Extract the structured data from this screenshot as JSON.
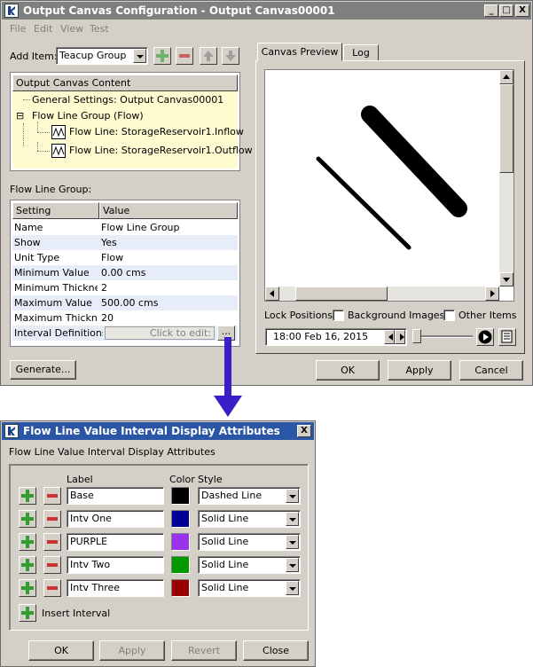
{
  "main_window": {
    "title": "Output Canvas Configuration - Output Canvas00001",
    "title_buttons": [
      "_",
      "□",
      "X"
    ],
    "menu": [
      "File",
      "Edit",
      "View",
      "Test"
    ],
    "add_item_label": "Add Item:",
    "add_item_value": "Teacup Group",
    "content_header": "Output Canvas Content",
    "tree": {
      "general": "General Settings: Output Canvas00001",
      "group": "Flow Line Group (Flow)",
      "expander": "⊟",
      "child1": "Flow Line: StorageReservoir1.Inflow",
      "child2": "Flow Line: StorageReservoir1.Outflow"
    },
    "group_section_label": "Flow Line Group:",
    "settings_headers": [
      "Setting",
      "Value"
    ],
    "settings": [
      {
        "setting": "Name",
        "value": "Flow Line Group"
      },
      {
        "setting": "Show",
        "value": "Yes"
      },
      {
        "setting": "Unit Type",
        "value": "Flow"
      },
      {
        "setting": "Minimum Value",
        "value": "0.00 cms"
      },
      {
        "setting": "Minimum Thickness",
        "value": "2"
      },
      {
        "setting": "Maximum Value",
        "value": "500.00 cms"
      },
      {
        "setting": "Maximum Thickness",
        "value": "20"
      }
    ],
    "interval_def_label": "Interval Definitions",
    "interval_def_value": "Click to edit:",
    "ellipsis": "...",
    "generate_button": "Generate...",
    "tabs": [
      "Canvas Preview",
      "Log"
    ],
    "lock_positions_label": "Lock Positions:",
    "lock_bg_label": "Background Images",
    "lock_other_label": "Other Items",
    "datetime": "18:00 Feb 16, 2015",
    "ok": "OK",
    "apply": "Apply",
    "cancel": "Cancel"
  },
  "dialog": {
    "title": "Flow Line Value Interval Display Attributes",
    "close": "X",
    "subtitle": "Flow Line Value Interval Display Attributes",
    "headers": {
      "label": "Label",
      "color": "Color",
      "style": "Style"
    },
    "intervals": [
      {
        "label": "Base",
        "color": "#000000",
        "style": "Dashed Line"
      },
      {
        "label": "Intv One",
        "color": "#000099",
        "style": "Solid Line"
      },
      {
        "label": "PURPLE",
        "color": "#9933ee",
        "style": "Solid Line"
      },
      {
        "label": "Intv Two",
        "color": "#009900",
        "style": "Solid Line"
      },
      {
        "label": "Intv Three",
        "color": "#990000",
        "style": "Solid Line"
      }
    ],
    "insert_interval": "Insert Interval",
    "ok": "OK",
    "apply": "Apply",
    "revert": "Revert",
    "close_button": "Close"
  },
  "colors": {
    "accent_arrow": "#3a1ec8",
    "tree_highlight": "#fffbd0",
    "row_alt": "#e6ecf8"
  }
}
